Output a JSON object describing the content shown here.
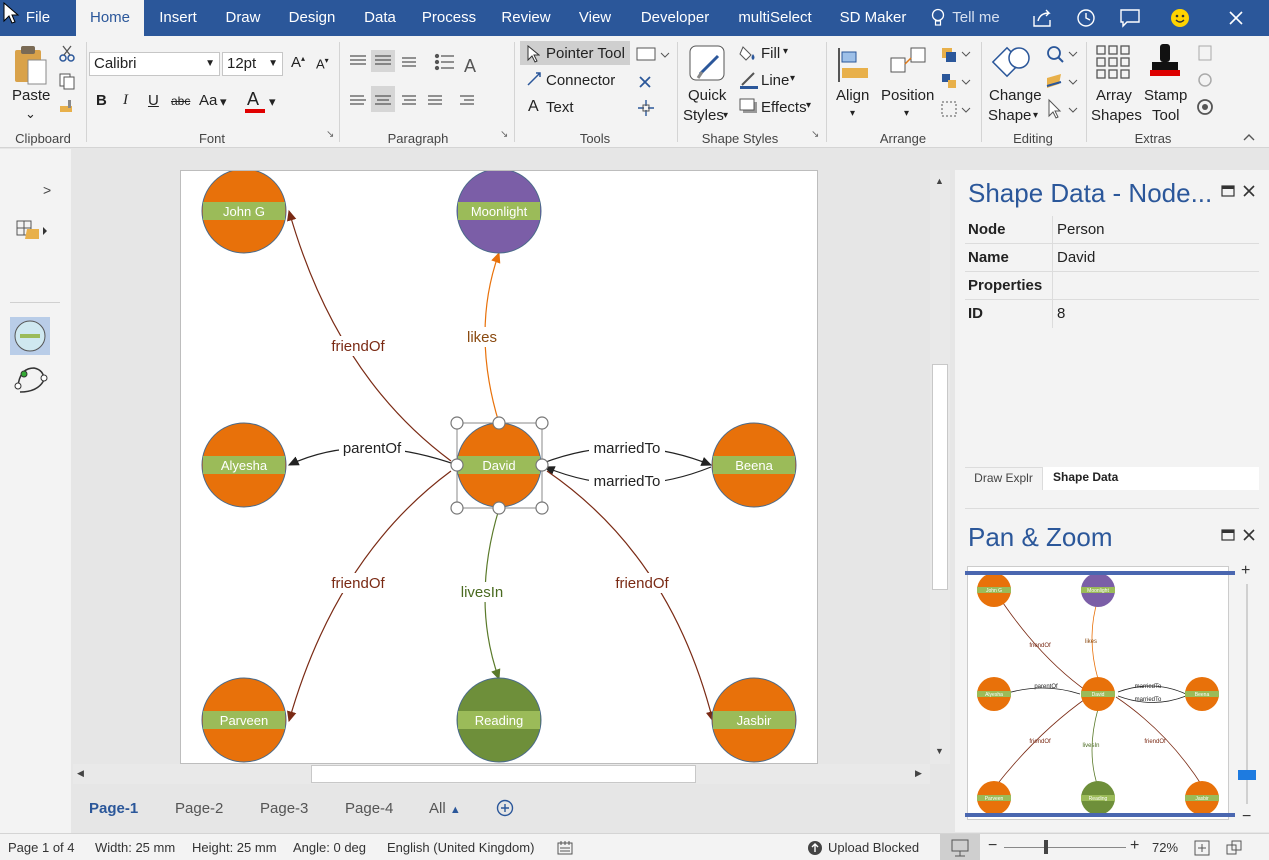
{
  "menubar": {
    "tabs": [
      "File",
      "Home",
      "Insert",
      "Draw",
      "Design",
      "Data",
      "Process",
      "Review",
      "View",
      "Developer",
      "multiSelect",
      "SD Maker"
    ],
    "tell_me": "Tell me",
    "active_tab": "Home",
    "color": "#2b579a"
  },
  "ribbon": {
    "clipboard": {
      "paste": "Paste",
      "label": "Clipboard"
    },
    "font": {
      "family": "Calibri",
      "size": "12pt",
      "label": "Font",
      "bold": "B",
      "italic": "I",
      "underline": "U",
      "strike": "abc",
      "case": "Aa",
      "color_a": "A"
    },
    "paragraph": {
      "label": "Paragraph"
    },
    "tools": {
      "pointer": "Pointer Tool",
      "connector": "Connector",
      "text": "Text",
      "label": "Tools"
    },
    "shape_styles": {
      "quick_styles_1": "Quick",
      "quick_styles_2": "Styles",
      "fill": "Fill",
      "line": "Line",
      "effects": "Effects",
      "label": "Shape Styles"
    },
    "arrange": {
      "align": "Align",
      "position": "Position",
      "label": "Arrange"
    },
    "editing": {
      "change_shape_1": "Change",
      "change_shape_2": "Shape",
      "label": "Editing"
    },
    "extras": {
      "array_1": "Array",
      "array_2": "Shapes",
      "stamp_1": "Stamp",
      "stamp_2": "Tool",
      "label": "Extras"
    }
  },
  "diagram": {
    "nodes": [
      {
        "id": "john",
        "label": "John G",
        "color": "#e8710a"
      },
      {
        "id": "moonlight",
        "label": "Moonlight",
        "color": "#7b5ea7"
      },
      {
        "id": "alyesha",
        "label": "Alyesha",
        "color": "#e8710a"
      },
      {
        "id": "david",
        "label": "David",
        "color": "#e8710a"
      },
      {
        "id": "beena",
        "label": "Beena",
        "color": "#e8710a"
      },
      {
        "id": "parveen",
        "label": "Parveen",
        "color": "#e8710a"
      },
      {
        "id": "reading",
        "label": "Reading",
        "color": "#6e8f3a"
      },
      {
        "id": "jasbir",
        "label": "Jasbir",
        "color": "#e8710a"
      }
    ],
    "edges": [
      {
        "label": "friendOf",
        "color": "#7a2a14"
      },
      {
        "label": "likes",
        "color": "#e8710a"
      },
      {
        "label": "parentOf",
        "color": "#222222"
      },
      {
        "label": "marriedTo",
        "color": "#222222"
      },
      {
        "label": "marriedTo",
        "color": "#222222"
      },
      {
        "label": "friendOf",
        "color": "#7a2a14"
      },
      {
        "label": "livesIn",
        "color": "#5a7a2a"
      },
      {
        "label": "friendOf",
        "color": "#7a2a14"
      }
    ],
    "band_color": "#9bbb59",
    "selected": "David"
  },
  "page_tabs": {
    "tabs": [
      "Page-1",
      "Page-2",
      "Page-3",
      "Page-4"
    ],
    "all": "All",
    "active": "Page-1"
  },
  "shape_data": {
    "title": "Shape Data - Node...",
    "rows": [
      {
        "key": "Node",
        "value": "Person"
      },
      {
        "key": "Name",
        "value": "David"
      },
      {
        "key": "Properties",
        "value": ""
      },
      {
        "key": "ID",
        "value": "8"
      }
    ],
    "tabs": [
      "Draw Explr",
      "Shape Data"
    ]
  },
  "pan_zoom": {
    "title": "Pan & Zoom"
  },
  "statusbar": {
    "page": "Page 1 of 4",
    "width": "Width: 25 mm",
    "height": "Height: 25 mm",
    "angle": "Angle: 0 deg",
    "language": "English (United Kingdom)",
    "upload": "Upload Blocked",
    "zoom": "72%"
  }
}
